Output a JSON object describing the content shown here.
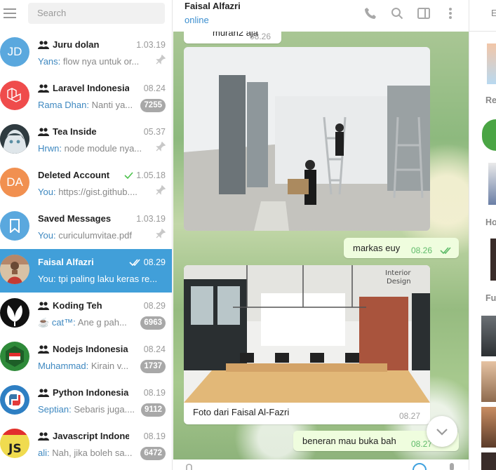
{
  "search": {
    "placeholder": "Search"
  },
  "chats": [
    {
      "name": "Juru dolan",
      "time": "1.03.19",
      "sender": "Yans:",
      "preview": "flow nya untuk or...",
      "pinned": true,
      "group": true,
      "avatar_text": "JD",
      "avatar_color": "#5aa8de"
    },
    {
      "name": "Laravel Indonesia",
      "time": "08.24",
      "sender": "Rama Dhan:",
      "preview": "Nanti ya...",
      "badge": "7255",
      "group": true,
      "avatar_color": "#ef4c4c"
    },
    {
      "name": "Tea Inside",
      "time": "05.37",
      "sender": "Hrwn:",
      "preview": "node module nya...",
      "pinned": true,
      "group": true,
      "avatar_color": "#3d4a4f"
    },
    {
      "name": "Deleted Account",
      "time": "1.05.18",
      "sender": "You:",
      "preview": "https://gist.github....",
      "pinned": true,
      "read": true,
      "avatar_text": "DA",
      "avatar_color": "#f19050"
    },
    {
      "name": "Saved Messages",
      "time": "1.03.19",
      "sender": "You:",
      "preview": "curiculumvitae.pdf",
      "pinned": true,
      "avatar_color": "#5aa8de"
    },
    {
      "name": "Faisal Alfazri",
      "time": "08.29",
      "sender": "You:",
      "preview": "tpi paling laku keras re...",
      "read": true,
      "active": true,
      "avatar_color": "#c9a07d"
    },
    {
      "name": "Koding Teh",
      "time": "08.29",
      "sender_prefix": "☕",
      "sender": "cat™:",
      "preview": "Ane g pah...",
      "badge": "6963",
      "group": true,
      "avatar_color": "#111111"
    },
    {
      "name": "Nodejs Indonesia",
      "time": "08.24",
      "sender": "Muhammad:",
      "preview": "Kirain v...",
      "badge": "1737",
      "group": true,
      "avatar_color": "#2e8a39"
    },
    {
      "name": "Python Indonesia",
      "time": "08.19",
      "sender": "Septian:",
      "preview": "Sebaris juga....",
      "badge": "9112",
      "group": true,
      "avatar_color": "#2e7fc3"
    },
    {
      "name": "Javascript Indone...",
      "time": "08.19",
      "sender": "ali:",
      "preview": "Nah, jika boleh sa...",
      "badge": "6472",
      "group": true,
      "avatar_color": "#f0db4f"
    }
  ],
  "header": {
    "name": "Faisal Alfazri",
    "status": "online"
  },
  "messages": {
    "m1": {
      "text": "muran2 aja",
      "time": "08.26"
    },
    "m2": {
      "text": "markas euy",
      "time": "08.26"
    },
    "m3": {
      "caption": "Foto dari Faisal Al-Fazri",
      "time": "08.27",
      "photo_watermark": "Interior Design"
    },
    "m4": {
      "text": "beneran mau buka bah",
      "time": "08.27"
    }
  },
  "right_panel": {
    "tab": "E",
    "sections": [
      "Re",
      "Ho",
      "Fu"
    ]
  },
  "colors": {
    "accent": "#419fd9",
    "badge": "#a8a8a8",
    "outgoing_bubble": "#effdde",
    "check": "#4dc24d"
  }
}
